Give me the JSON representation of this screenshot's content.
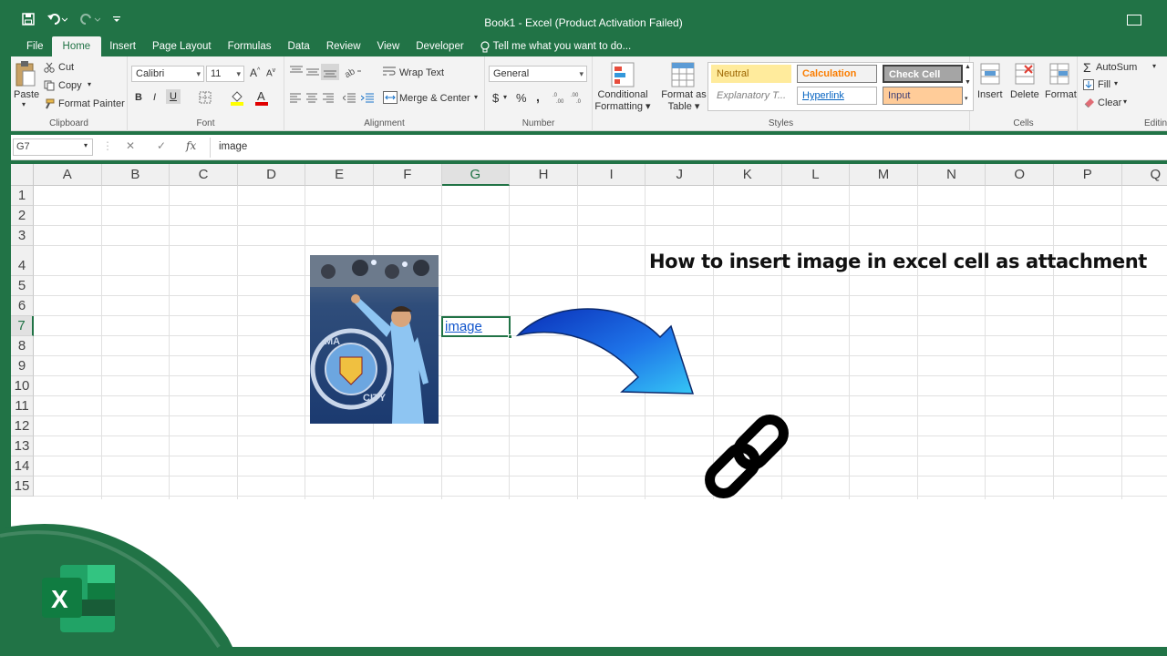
{
  "window": {
    "title": "Book1 - Excel (Product Activation Failed)"
  },
  "tabs": [
    "File",
    "Home",
    "Insert",
    "Page Layout",
    "Formulas",
    "Data",
    "Review",
    "View",
    "Developer"
  ],
  "tell_me": "Tell me what you want to do...",
  "clipboard": {
    "paste": "Paste",
    "cut": "Cut",
    "copy": "Copy",
    "format_painter": "Format Painter",
    "label": "Clipboard"
  },
  "font": {
    "name": "Calibri",
    "size": "11",
    "bold": "B",
    "italic": "I",
    "underline": "U",
    "label": "Font"
  },
  "alignment": {
    "wrap": "Wrap Text",
    "merge": "Merge & Center",
    "label": "Alignment"
  },
  "number": {
    "format": "General",
    "currency": "$",
    "percent": "%",
    "comma": ",",
    "label": "Number"
  },
  "styles": {
    "conditional": [
      "Conditional",
      "Formatting"
    ],
    "format_table": [
      "Format as",
      "Table"
    ],
    "neutral": "Neutral",
    "calculation": "Calculation",
    "check_cell": "Check Cell",
    "explanatory": "Explanatory T...",
    "hyperlink": "Hyperlink",
    "input": "Input",
    "label": "Styles"
  },
  "cells": {
    "insert": "Insert",
    "delete": "Delete",
    "format": "Format",
    "label": "Cells"
  },
  "editing": {
    "autosum": "AutoSum",
    "fill": "Fill",
    "clear": "Clear",
    "label": "Editin"
  },
  "formula_bar": {
    "name_box": "G7",
    "fx": "fx",
    "value": "image"
  },
  "columns": [
    "A",
    "B",
    "C",
    "D",
    "E",
    "F",
    "G",
    "H",
    "I",
    "J",
    "K",
    "L",
    "M",
    "N",
    "O",
    "P",
    "Q"
  ],
  "rows": [
    "1",
    "2",
    "3",
    "4",
    "5",
    "6",
    "7",
    "8",
    "9",
    "10",
    "11",
    "12",
    "13",
    "14",
    "15"
  ],
  "cell_link_text": "image",
  "headline": "How to insert image in excel cell as attachment",
  "colors": {
    "excel_green": "#217346",
    "arrow_blue": "#1e73e8",
    "link": "#1155cc"
  }
}
